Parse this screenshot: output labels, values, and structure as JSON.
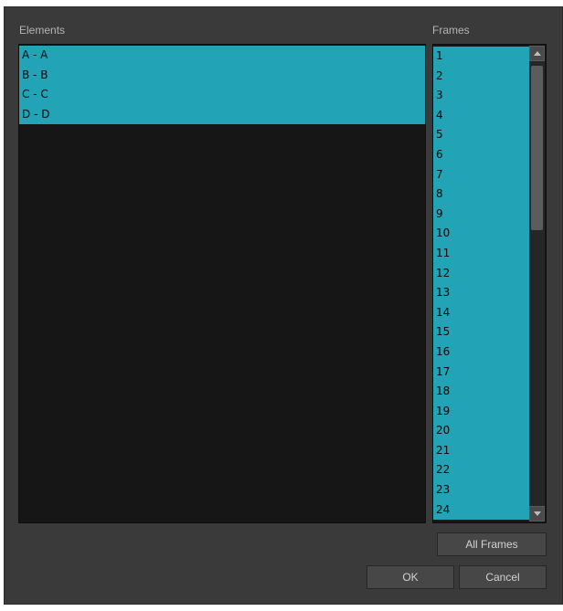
{
  "elements_label": "Elements",
  "frames_label": "Frames",
  "elements": [
    "A - A",
    "B - B",
    "C - C",
    "D - D"
  ],
  "frames": [
    "1",
    "2",
    "3",
    "4",
    "5",
    "6",
    "7",
    "8",
    "9",
    "10",
    "11",
    "12",
    "13",
    "14",
    "15",
    "16",
    "17",
    "18",
    "19",
    "20",
    "21",
    "22",
    "23",
    "24"
  ],
  "buttons": {
    "all_frames": "All Frames",
    "ok": "OK",
    "cancel": "Cancel"
  },
  "colors": {
    "selection": "#23a3b6",
    "list_background": "#161616",
    "dialog_background": "#3a3a3a"
  }
}
